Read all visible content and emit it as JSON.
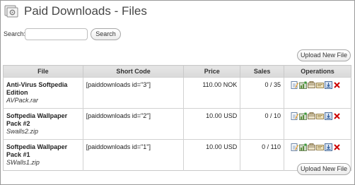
{
  "page": {
    "title": "Paid Downloads - Files"
  },
  "search": {
    "label": "Search:",
    "value": "",
    "placeholder": "",
    "button_label": "Search"
  },
  "upload_button_label": "Upload New File",
  "table": {
    "headers": {
      "file": "File",
      "short_code": "Short Code",
      "price": "Price",
      "sales": "Sales",
      "operations": "Operations"
    },
    "rows": [
      {
        "name": "Anti-Virus Softpedia Edition",
        "filename": "AVPack.rar",
        "short_code": "[paiddownloads id=\"3\"]",
        "price": "110.00 NOK",
        "sales": "0 / 35"
      },
      {
        "name": "Softpedia Wallpaper Pack #2",
        "filename": "Swalls2.zip",
        "short_code": "[paiddownloads id=\"2\"]",
        "price": "10.00 USD",
        "sales": "0 / 10"
      },
      {
        "name": "Softpedia Wallpaper Pack #1",
        "filename": "SWalls1.zip",
        "short_code": "[paiddownloads id=\"1\"]",
        "price": "10.00 USD",
        "sales": "0 / 110"
      }
    ],
    "operation_icons": [
      "edit-icon",
      "stats-icon",
      "links-icon",
      "transactions-icon",
      "download-icon",
      "delete-icon"
    ]
  },
  "colors": {
    "header_bg": "#dcdcdc",
    "delete_red": "#cc0000",
    "title": "#464646"
  }
}
